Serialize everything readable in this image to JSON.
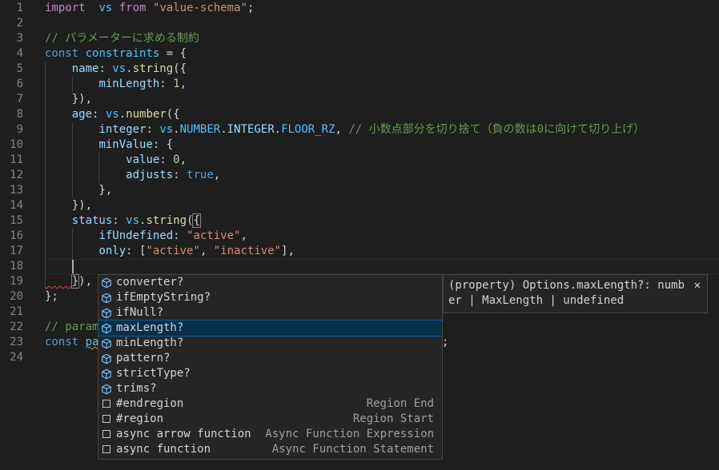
{
  "editor": {
    "line_numbers": [
      "1",
      "2",
      "3",
      "4",
      "5",
      "6",
      "7",
      "8",
      "9",
      "10",
      "11",
      "12",
      "13",
      "14",
      "15",
      "16",
      "17",
      "18",
      "19",
      "20",
      "21",
      "22",
      "23",
      "24"
    ],
    "lines": [
      [
        [
          "k",
          "import"
        ],
        [
          "",
          "  "
        ],
        [
          "v",
          "vs"
        ],
        [
          "",
          ""
        ],
        [
          "k",
          " from"
        ],
        [
          "",
          " "
        ],
        [
          "s",
          "\"value-schema\""
        ],
        [
          "",
          ";"
        ]
      ],
      [],
      [
        [
          "c",
          "// パラメーターに求める制約"
        ]
      ],
      [
        [
          "kb",
          "const"
        ],
        [
          "",
          " "
        ],
        [
          "v",
          "constraints"
        ],
        [
          "",
          " = {"
        ]
      ],
      [
        [
          "",
          "    "
        ],
        [
          "p",
          "name"
        ],
        [
          "",
          ": "
        ],
        [
          "v",
          "vs"
        ],
        [
          "",
          "."
        ],
        [
          "f",
          "string"
        ],
        [
          "",
          "({"
        ]
      ],
      [
        [
          "",
          "        "
        ],
        [
          "p",
          "minLength"
        ],
        [
          "",
          ": "
        ],
        [
          "n",
          "1"
        ],
        [
          "",
          ","
        ]
      ],
      [
        [
          "",
          "    }),"
        ]
      ],
      [
        [
          "",
          "    "
        ],
        [
          "p",
          "age"
        ],
        [
          "",
          ": "
        ],
        [
          "v",
          "vs"
        ],
        [
          "",
          "."
        ],
        [
          "f",
          "number"
        ],
        [
          "",
          "({"
        ]
      ],
      [
        [
          "",
          "        "
        ],
        [
          "p",
          "integer"
        ],
        [
          "",
          ": "
        ],
        [
          "v",
          "vs"
        ],
        [
          "",
          "."
        ],
        [
          "v",
          "NUMBER"
        ],
        [
          "",
          "."
        ],
        [
          "p",
          "INTEGER"
        ],
        [
          "",
          "."
        ],
        [
          "v",
          "FLOOR_RZ"
        ],
        [
          "",
          ", "
        ],
        [
          "c",
          "// 小数点部分を切り捨て（負の数は0に向けて切り上げ）"
        ]
      ],
      [
        [
          "",
          "        "
        ],
        [
          "p",
          "minValue"
        ],
        [
          "",
          ": {"
        ]
      ],
      [
        [
          "",
          "            "
        ],
        [
          "p",
          "value"
        ],
        [
          "",
          ": "
        ],
        [
          "n",
          "0"
        ],
        [
          "",
          ","
        ]
      ],
      [
        [
          "",
          "            "
        ],
        [
          "p",
          "adjusts"
        ],
        [
          "",
          ": "
        ],
        [
          "kb",
          "true"
        ],
        [
          "",
          ","
        ]
      ],
      [
        [
          "",
          "        },"
        ]
      ],
      [
        [
          "",
          "    }),"
        ]
      ],
      [
        [
          "",
          "    "
        ],
        [
          "p",
          "status"
        ],
        [
          "",
          ": "
        ],
        [
          "v",
          "vs"
        ],
        [
          "",
          "."
        ],
        [
          "f",
          "string"
        ],
        [
          "",
          "("
        ],
        [
          "bm",
          "{"
        ]
      ],
      [
        [
          "",
          "        "
        ],
        [
          "p",
          "ifUndefined"
        ],
        [
          "",
          ": "
        ],
        [
          "s",
          "\"active\""
        ],
        [
          "",
          ","
        ]
      ],
      [
        [
          "",
          "        "
        ],
        [
          "p",
          "only"
        ],
        [
          "",
          ": ["
        ],
        [
          "s",
          "\"active\""
        ],
        [
          "",
          ", "
        ],
        [
          "s",
          "\"inactive\""
        ],
        [
          "",
          "],"
        ]
      ],
      [],
      [
        [
          "",
          "    "
        ],
        [
          "bm",
          "}"
        ],
        [
          "",
          "),"
        ]
      ],
      [
        [
          "",
          "};"
        ]
      ],
      [],
      [
        [
          "c",
          "// param"
        ]
      ],
      [
        [
          "kb",
          "const"
        ],
        [
          "",
          " "
        ],
        [
          "v",
          "pa"
        ]
      ],
      []
    ],
    "line23_tail": ";"
  },
  "suggest": {
    "items": [
      {
        "kind": "property",
        "label": "converter?",
        "detail": ""
      },
      {
        "kind": "property",
        "label": "ifEmptyString?",
        "detail": ""
      },
      {
        "kind": "property",
        "label": "ifNull?",
        "detail": ""
      },
      {
        "kind": "property",
        "label": "maxLength?",
        "detail": "",
        "selected": true
      },
      {
        "kind": "property",
        "label": "minLength?",
        "detail": ""
      },
      {
        "kind": "property",
        "label": "pattern?",
        "detail": ""
      },
      {
        "kind": "property",
        "label": "strictType?",
        "detail": ""
      },
      {
        "kind": "property",
        "label": "trims?",
        "detail": ""
      },
      {
        "kind": "snippet",
        "label": "#endregion",
        "detail": "Region End"
      },
      {
        "kind": "snippet",
        "label": "#region",
        "detail": "Region Start"
      },
      {
        "kind": "snippet",
        "label": "async arrow function",
        "detail": "Async Function Expression"
      },
      {
        "kind": "snippet",
        "label": "async function",
        "detail": "Async Function Statement"
      }
    ]
  },
  "details": {
    "line1": "(property) Options.maxLength?: numb",
    "line2": "er | MaxLength | undefined",
    "close_glyph": "✕"
  },
  "colors": {
    "background": "#1e1e1e",
    "keyword_control": "#c586c0",
    "keyword": "#569cd6",
    "variable": "#4fc1ff",
    "property": "#9cdcfe",
    "function": "#dcdcaa",
    "string": "#ce9178",
    "number": "#b5cea8",
    "comment": "#6a9955",
    "selection": "#062f4a"
  },
  "icons": {
    "property": "cube-icon",
    "snippet": "square-icon",
    "close": "close-icon"
  }
}
